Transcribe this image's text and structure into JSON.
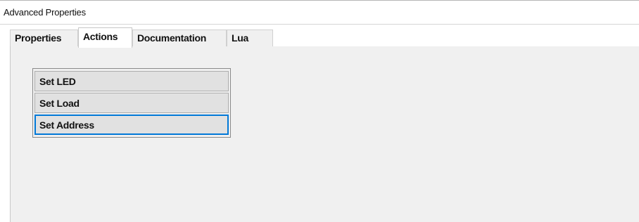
{
  "window": {
    "title": "Advanced Properties"
  },
  "tabs": [
    {
      "label": "Properties",
      "active": false
    },
    {
      "label": "Actions",
      "active": true
    },
    {
      "label": "Documentation",
      "active": false
    },
    {
      "label": "Lua",
      "active": false
    }
  ],
  "actions": [
    {
      "label": "Set LED",
      "focused": false
    },
    {
      "label": "Set Load",
      "focused": false
    },
    {
      "label": "Set Address",
      "focused": true
    }
  ],
  "colors": {
    "panel_bg": "#f0f0f0",
    "button_bg": "#e1e1e1",
    "focus_border": "#0078d7"
  }
}
